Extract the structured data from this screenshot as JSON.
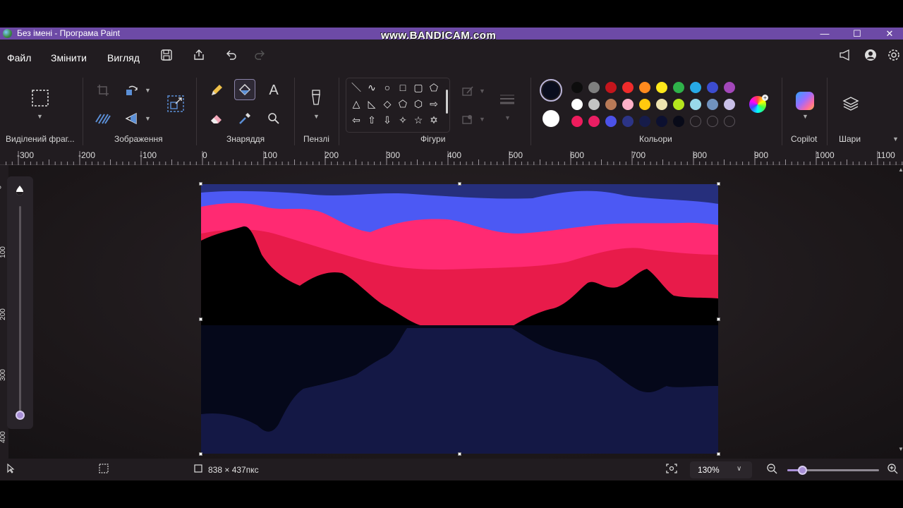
{
  "window": {
    "title": "Без імені - Програма Paint",
    "watermark": "www.BANDICAM.com",
    "minimize": "—",
    "maximize": "☐",
    "close": "✕"
  },
  "menu": {
    "file": "Файл",
    "edit": "Змінити",
    "view": "Вигляд"
  },
  "ribbon": {
    "groups": {
      "selection": "Виділений фраг...",
      "image": "Зображення",
      "tools": "Знаряддя",
      "brushes": "Пензлі",
      "shapes": "Фігури",
      "colors": "Кольори",
      "copilot": "Copilot",
      "layers": "Шари"
    },
    "text_tool_glyph": "A",
    "shapes": [
      "＼",
      "∿",
      "○",
      "□",
      "▢",
      "⬠",
      "△",
      "◺",
      "◇",
      "⬠",
      "⬡",
      "⇨",
      "⇦",
      "⇧",
      "⇩",
      "✧",
      "☆",
      "✡"
    ],
    "palette_rows": [
      [
        "#0d0d0d",
        "#7f7f7f",
        "#c4151c",
        "#ef2b2b",
        "#ff8a1e",
        "#ffe81a",
        "#2fb24a",
        "#27a9e6",
        "#3c4ccf",
        "#a347ba"
      ],
      [
        "#ffffff",
        "#c3c3c3",
        "#b97a57",
        "#ffb1c8",
        "#ffc90e",
        "#efe4b0",
        "#b5e61d",
        "#99d9ea",
        "#7092be",
        "#c8bfe7"
      ],
      [
        "#ee1c5d",
        "#e91e63",
        "#4c52e8",
        "#2c3486",
        "#161c4a",
        "#0c1030",
        "#080a18",
        "",
        "",
        ""
      ]
    ],
    "color1": "#0a0d1e",
    "color2": "#ffffff"
  },
  "ruler": {
    "h_labels": [
      "-300",
      "-200",
      "-100",
      "0",
      "100",
      "200",
      "300",
      "400",
      "500",
      "600",
      "700",
      "800",
      "900",
      "1000",
      "1100"
    ],
    "v_labels": [
      "0",
      "100",
      "200",
      "300",
      "400"
    ]
  },
  "canvas": {
    "colors": {
      "sky_top": "#262f7c",
      "sky_blue": "#4c59f4",
      "pink": "#ff2a72",
      "red": "#e81b4a",
      "mountain": "#000000",
      "water_dark": "#05081a",
      "water_reflection": "#141845"
    }
  },
  "status": {
    "canvas_size": "838 × 437пкс",
    "zoom": "130%"
  }
}
